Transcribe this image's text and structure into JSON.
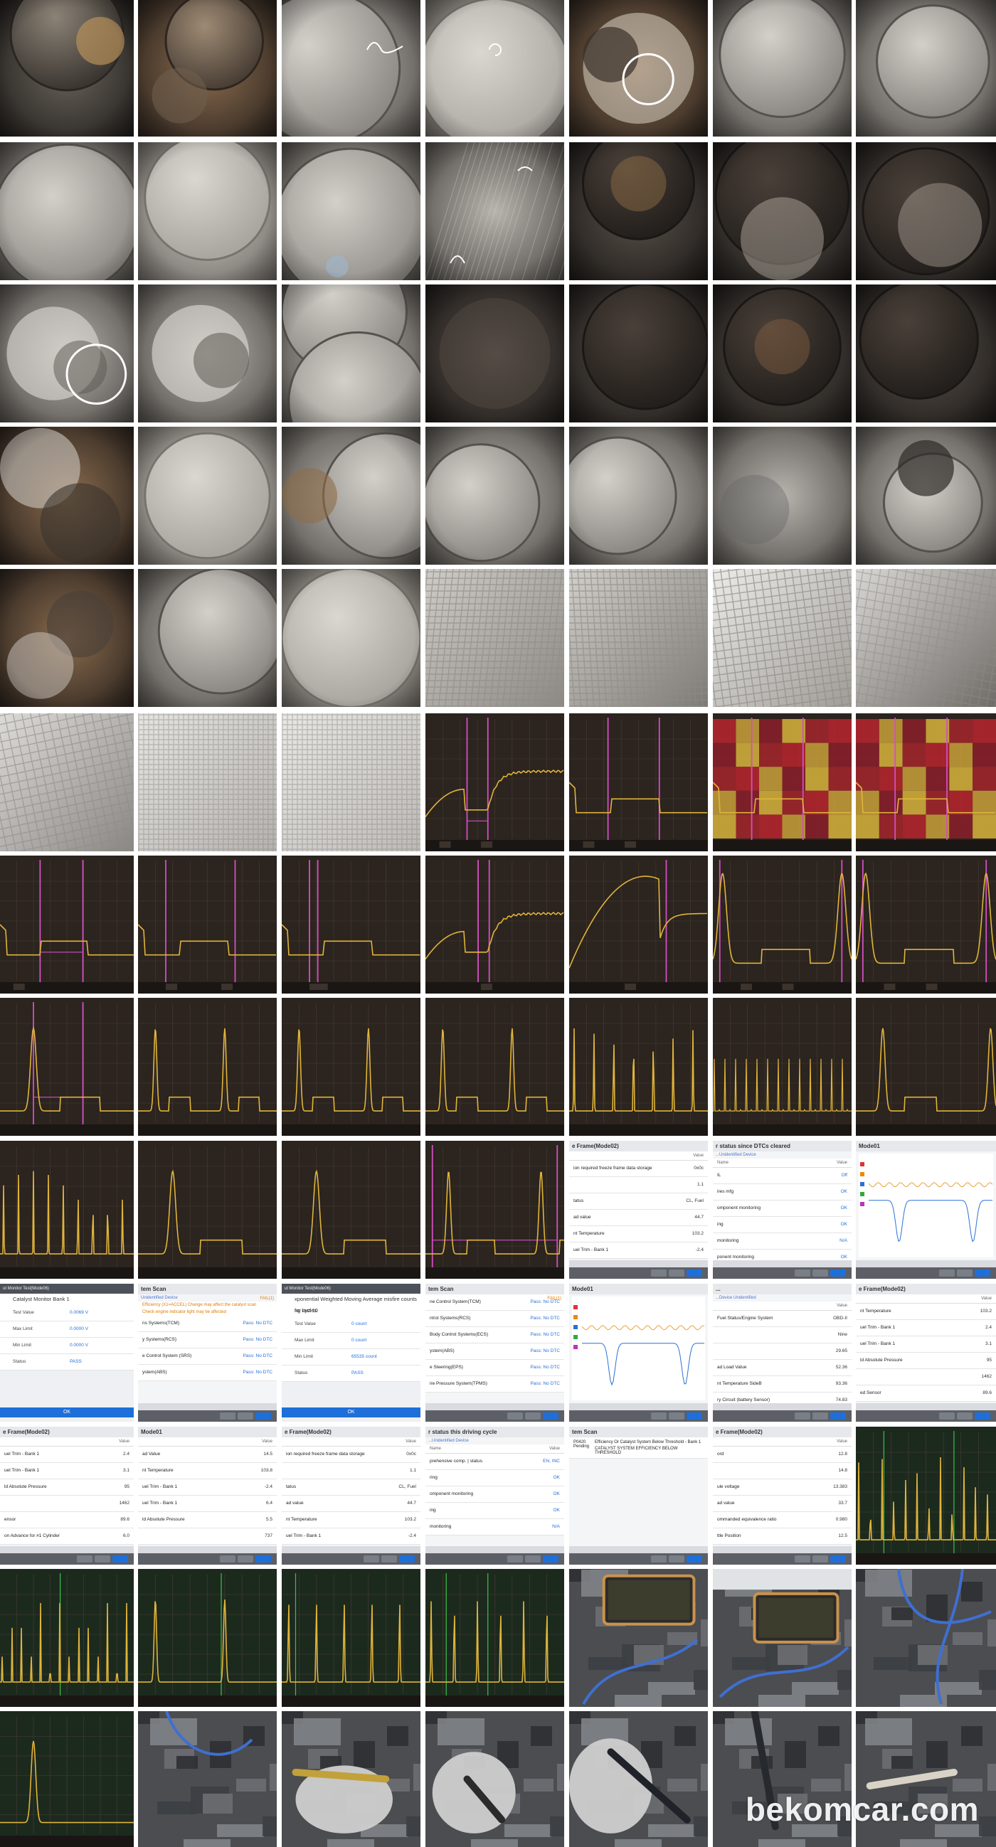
{
  "watermark": "bekomcar.com",
  "colors": {
    "scope_bg": "#2b241f",
    "scope_bg_green": "#1c2a1e",
    "trace": "#e0b43a",
    "cursor": "#d44fc3",
    "scan_accent": "#1e6fd9",
    "ok_text": "#2a6fd6"
  },
  "screens": {
    "freeze_frame_a": {
      "title": "e Frame(Mode02)",
      "value_col": "Value",
      "rows": [
        {
          "label": "ion required freeze frame data storage",
          "value": "0x0c"
        },
        {
          "label": "",
          "value": "1.1"
        },
        {
          "label": "tatus",
          "value": "CL, Fuel"
        },
        {
          "label": "ad value",
          "value": "44.7"
        },
        {
          "label": "nt Temperature",
          "value": "103.2"
        },
        {
          "label": "uel Trim - Bank 1",
          "value": "-2.4"
        }
      ]
    },
    "monitor_status_dtc": {
      "title": "r status since DTCs cleared",
      "subtitle": "...Unidentified Device",
      "name_col": "Name",
      "value_col": "Value",
      "rows": [
        {
          "label": "IL",
          "value": "Off"
        },
        {
          "label": "ires mfg",
          "value": "OK"
        },
        {
          "label": "omponent monitoring",
          "value": "OK"
        },
        {
          "label": "ing",
          "value": "OK"
        },
        {
          "label": "monitoring",
          "value": "N/A"
        },
        {
          "label": "ponent monitoring",
          "value": "OK"
        }
      ]
    },
    "mode01_graph": {
      "title": "Mode01"
    },
    "catalyst_modal": {
      "header": "ut Monitor Test(Mode06)",
      "title": "Catalyst Monitor Bank 1",
      "rows": [
        {
          "label": "Test Value",
          "value": "0.0069 V"
        },
        {
          "label": "Max Limit",
          "value": "0.0000 V"
        },
        {
          "label": "Min Limit",
          "value": "0.0000 V"
        },
        {
          "label": "Status",
          "value": "PASS"
        }
      ],
      "ok": "OK"
    },
    "system_scan_a": {
      "title": "tem Scan",
      "subtitle": "Unidentified Device",
      "badge": "FAIL(1)",
      "warn_lines": [
        "Efficiency (X1=ACCEL) Change may affect the catalyst scan",
        "Check engine indicator light may be affected"
      ],
      "rows": [
        {
          "label": "ns Systems(TCM)",
          "value": "Pass: No DTC"
        },
        {
          "label": "y Systems(RCS)",
          "value": "Pass: No DTC"
        },
        {
          "label": "e Control System (SRS)",
          "value": "Pass: No DTC"
        },
        {
          "label": "ystem(ABS)",
          "value": "Pass: No DTC"
        }
      ]
    },
    "exp_moving_modal": {
      "header": "ut Monitor Test(Mode06)",
      "title": "xponential Weighted Moving Average misfire counts for last 10",
      "subtitle": "ng cycles",
      "rows": [
        {
          "label": "Test Value",
          "value": "0 count"
        },
        {
          "label": "Max Limit",
          "value": "0 count"
        },
        {
          "label": "Min Limit",
          "value": "65535 count"
        },
        {
          "label": "Status",
          "value": "PASS"
        }
      ],
      "ok": "OK"
    },
    "system_scan_b": {
      "title": "tem Scan",
      "badge": "FAIL(1)",
      "rows": [
        {
          "label": "ne Control System(TCM)",
          "value": "Pass: No DTC"
        },
        {
          "label": "ntrol Systems(RCS)",
          "value": "Pass: No DTC"
        },
        {
          "label": "Body Control Systems(ECS)",
          "value": "Pass: No DTC"
        },
        {
          "label": "ystem(ABS)",
          "value": "Pass: No DTC"
        },
        {
          "label": "e Steering(EPS)",
          "value": "Pass: No DTC"
        },
        {
          "label": "ire Pressure System(TPMS)",
          "value": "Pass: No DTC"
        }
      ]
    },
    "mode01_b": {
      "title": "Mode01"
    },
    "mode01_list": {
      "title": "...",
      "subtitle": "...Device Unidentified",
      "value_col": "Value",
      "rows": [
        {
          "label": "Fuel Status/Engine System",
          "value": "OBD-II"
        },
        {
          "label": "",
          "value": "Nine"
        },
        {
          "label": "",
          "value": "29.65"
        },
        {
          "label": "ad Load Value",
          "value": "52.36"
        },
        {
          "label": "nt Temperature SideB",
          "value": "93.36"
        },
        {
          "label": "ry Circuit (battery Sensor)",
          "value": "74.83"
        }
      ]
    },
    "freeze_frame_b": {
      "title": "e Frame(Mode02)",
      "value_col": "Value",
      "rows": [
        {
          "label": "nt Temperature",
          "value": "103.2"
        },
        {
          "label": "uel Trim - Bank 1",
          "value": "2.4"
        },
        {
          "label": "uel Trim - Bank 1",
          "value": "3.1"
        },
        {
          "label": "ld Absolute Pressure",
          "value": "95"
        },
        {
          "label": "",
          "value": "1462"
        },
        {
          "label": "ed Sensor",
          "value": "89.6"
        }
      ]
    },
    "freeze_frame_c": {
      "title": "e Frame(Mode02)",
      "value_col": "Value",
      "rows": [
        {
          "label": "uel Trim - Bank 1",
          "value": "2.4"
        },
        {
          "label": "uel Trim - Bank 1",
          "value": "3.1"
        },
        {
          "label": "ld Absolute Pressure",
          "value": "95"
        },
        {
          "label": "",
          "value": "1462"
        },
        {
          "label": "ensor",
          "value": "89.6"
        },
        {
          "label": "on Advance for #1 Cylinder",
          "value": "6.0"
        }
      ]
    },
    "mode01_c": {
      "title": "Mode01",
      "value_col": "Value",
      "rows": [
        {
          "label": "ad Value",
          "value": "14.5"
        },
        {
          "label": "nt Temperature",
          "value": "103.8"
        },
        {
          "label": "uel Trim - Bank 1",
          "value": "-2.4"
        },
        {
          "label": "uel Trim - Bank 1",
          "value": "6.4"
        },
        {
          "label": "ld Absolute Pressure",
          "value": "5.5"
        },
        {
          "label": "",
          "value": "737"
        }
      ]
    },
    "freeze_frame_d": {
      "title": "e Frame(Mode02)",
      "value_col": "Value",
      "rows": [
        {
          "label": "ion required freeze frame data storage",
          "value": "0x0c"
        },
        {
          "label": "",
          "value": "1.1"
        },
        {
          "label": "tatus",
          "value": "CL, Fuel"
        },
        {
          "label": "ad value",
          "value": "44.7"
        },
        {
          "label": "nt Temperature",
          "value": "103.2"
        },
        {
          "label": "uel Trim - Bank 1",
          "value": "-2.4"
        }
      ]
    },
    "monitor_status_cycle": {
      "title": "r status this driving cycle",
      "subtitle": "...Unidentified Device",
      "name_col": "Name",
      "value_col": "Value",
      "rows": [
        {
          "label": "prehensive comp. | status",
          "value": "EN, INC"
        },
        {
          "label": "ring",
          "value": "OK"
        },
        {
          "label": "omponent monitoring",
          "value": "OK"
        },
        {
          "label": "ing",
          "value": "OK"
        },
        {
          "label": "monitoring",
          "value": "N/A"
        }
      ]
    },
    "dtc_scan": {
      "title": "tem Scan",
      "code": "P0420",
      "status": "Pending",
      "desc": "Efficiency Or Catalyst System Below Threshold - Bank 1",
      "desc2": "CATALYST SYSTEM EFFICIENCY BELOW THRESHOLD"
    },
    "freeze_frame_e": {
      "title": "e Frame(Mode02)",
      "value_col": "Value",
      "rows": [
        {
          "label": "ord",
          "value": "12.8"
        },
        {
          "label": "",
          "value": "14.8"
        },
        {
          "label": "ule voltage",
          "value": "13.383"
        },
        {
          "label": "ad value",
          "value": "33.7"
        },
        {
          "label": "ommanded equivalence ratio",
          "value": "0.980"
        },
        {
          "label": "ttle Position",
          "value": "12.5"
        }
      ]
    }
  }
}
